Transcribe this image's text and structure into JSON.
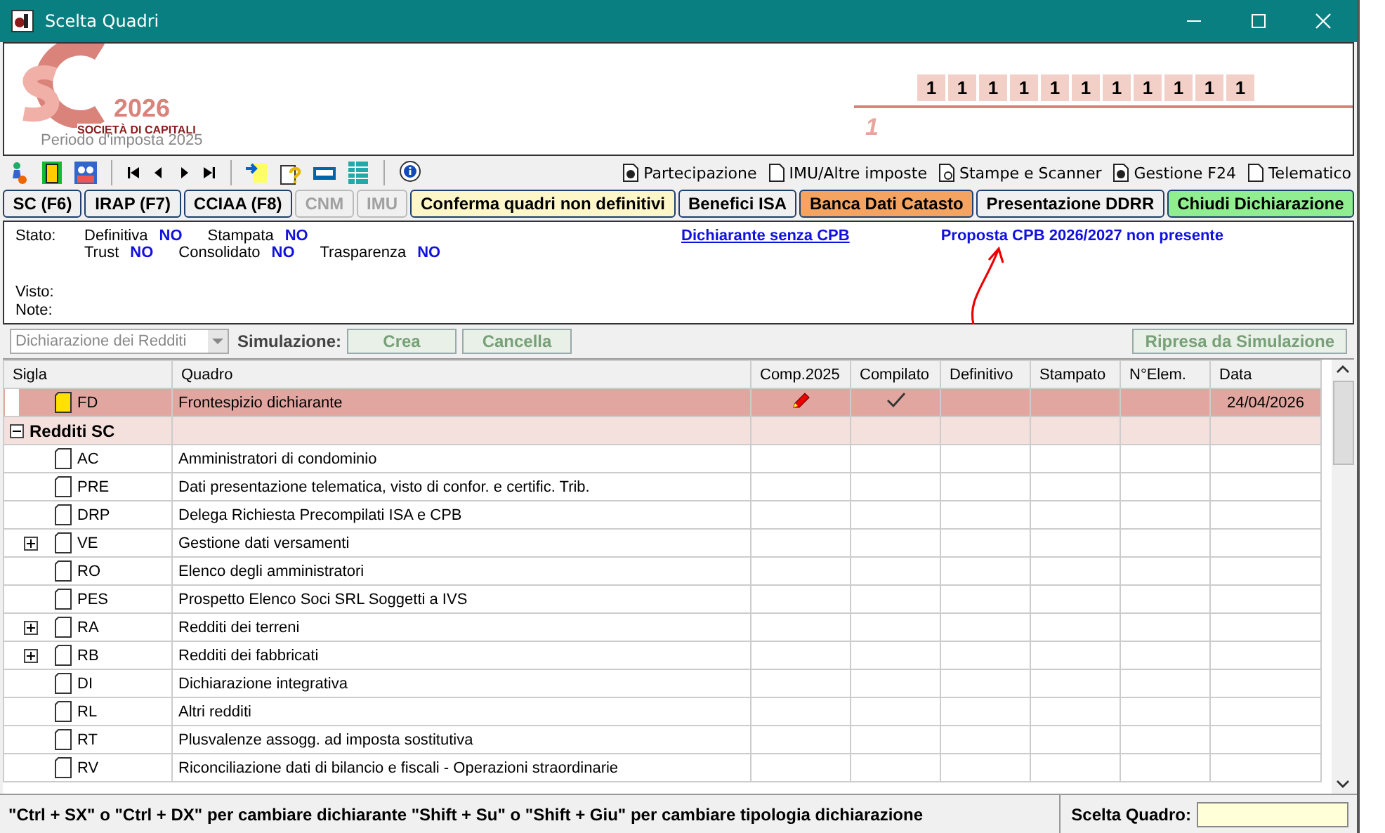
{
  "window": {
    "title": "Scelta Quadri"
  },
  "logo": {
    "year": "2026",
    "subtitle": "SOCIETÀ DI CAPITALI",
    "period": "Periodo d'imposta 2025"
  },
  "header": {
    "code_boxes": [
      "1",
      "1",
      "1",
      "1",
      "1",
      "1",
      "1",
      "1",
      "1",
      "1",
      "1"
    ],
    "page_number": "1"
  },
  "toolbar": {
    "links": [
      "Partecipazione",
      "IMU/Altre imposte",
      "Stampe e Scanner",
      "Gestione F24",
      "Telematico"
    ]
  },
  "action_buttons": [
    {
      "label": "SC (F6)",
      "disabled": false,
      "color": "#f0f0f0"
    },
    {
      "label": "IRAP (F7)",
      "disabled": false,
      "color": "#f0f0f0"
    },
    {
      "label": "CCIAA (F8)",
      "disabled": false,
      "color": "#f0f0f0"
    },
    {
      "label": "CNM",
      "disabled": true,
      "color": "#f0f0f0"
    },
    {
      "label": "IMU",
      "disabled": true,
      "color": "#f0f0f0"
    },
    {
      "label": "Conferma quadri non definitivi",
      "disabled": false,
      "color": "#fdf6c8"
    },
    {
      "label": "Benefici ISA",
      "disabled": false,
      "color": "#f0f0f0"
    },
    {
      "label": "Banca Dati Catasto",
      "disabled": false,
      "color": "#f4a460"
    },
    {
      "label": "Presentazione DDRR",
      "disabled": false,
      "color": "#f0f0f0"
    },
    {
      "label": "Chiudi Dichiarazione",
      "disabled": false,
      "color": "#90ee90"
    }
  ],
  "status": {
    "label": "Stato:",
    "flags_row_1": [
      {
        "label": "Definitiva",
        "value": "NO"
      },
      {
        "label": "Stampata",
        "value": "NO"
      }
    ],
    "flags_row_2": [
      {
        "label": "Trust",
        "value": "NO"
      },
      {
        "label": "Consolidato",
        "value": "NO"
      },
      {
        "label": "Trasparenza",
        "value": "NO"
      }
    ],
    "link": "Dichiarante senza CPB",
    "notice": "Proposta CPB 2026/2027 non presente",
    "visto_label": "Visto:",
    "note_label": "Note:"
  },
  "simulation": {
    "dropdown_value": "Dichiarazione dei Redditi",
    "label": "Simulazione:",
    "buttons": [
      {
        "label": "Crea",
        "disabled": true
      },
      {
        "label": "Cancella",
        "disabled": true
      }
    ],
    "resume_button": {
      "label": "Ripresa da Simulazione",
      "disabled": true
    }
  },
  "table": {
    "columns": [
      "Sigla",
      "Quadro",
      "Comp.2025",
      "Compilato",
      "Definitivo",
      "Stampato",
      "N°Elem.",
      "Data"
    ],
    "rows": [
      {
        "kind": "item",
        "sigla": "FD",
        "quadro": "Frontespizio dichiarante",
        "selected": true,
        "filled": true,
        "expandable": false,
        "comp_edit": true,
        "compilato": true,
        "data": "24/04/2026"
      },
      {
        "kind": "group",
        "label": "Redditi SC",
        "expanded": true
      },
      {
        "kind": "item",
        "sigla": "AC",
        "quadro": "Amministratori di condominio",
        "selected": false,
        "filled": false,
        "expandable": false,
        "comp_edit": false,
        "compilato": false
      },
      {
        "kind": "item",
        "sigla": "PRE",
        "quadro": "Dati presentazione telematica, visto di confor. e certific. Trib.",
        "selected": false,
        "filled": false,
        "expandable": false,
        "comp_edit": false,
        "compilato": false
      },
      {
        "kind": "item",
        "sigla": "DRP",
        "quadro": "Delega Richiesta Precompilati ISA e CPB",
        "selected": false,
        "filled": false,
        "expandable": false,
        "comp_edit": false,
        "compilato": false
      },
      {
        "kind": "item",
        "sigla": "VE",
        "quadro": "Gestione dati versamenti",
        "selected": false,
        "filled": false,
        "expandable": true,
        "comp_edit": false,
        "compilato": false
      },
      {
        "kind": "item",
        "sigla": "RO",
        "quadro": "Elenco degli amministratori",
        "selected": false,
        "filled": false,
        "expandable": false,
        "comp_edit": false,
        "compilato": false
      },
      {
        "kind": "item",
        "sigla": "PES",
        "quadro": "Prospetto Elenco Soci SRL Soggetti a IVS",
        "selected": false,
        "filled": false,
        "expandable": false,
        "comp_edit": false,
        "compilato": false
      },
      {
        "kind": "item",
        "sigla": "RA",
        "quadro": "Redditi dei terreni",
        "selected": false,
        "filled": false,
        "expandable": true,
        "comp_edit": false,
        "compilato": false
      },
      {
        "kind": "item",
        "sigla": "RB",
        "quadro": "Redditi dei fabbricati",
        "selected": false,
        "filled": false,
        "expandable": true,
        "comp_edit": false,
        "compilato": false
      },
      {
        "kind": "item",
        "sigla": "DI",
        "quadro": "Dichiarazione integrativa",
        "selected": false,
        "filled": false,
        "expandable": false,
        "comp_edit": false,
        "compilato": false
      },
      {
        "kind": "item",
        "sigla": "RL",
        "quadro": "Altri redditi",
        "selected": false,
        "filled": false,
        "expandable": false,
        "comp_edit": false,
        "compilato": false
      },
      {
        "kind": "item",
        "sigla": "RT",
        "quadro": "Plusvalenze assogg. ad imposta sostitutiva",
        "selected": false,
        "filled": false,
        "expandable": false,
        "comp_edit": false,
        "compilato": false
      },
      {
        "kind": "item",
        "sigla": "RV",
        "quadro": "Riconciliazione dati di bilancio e fiscali - Operazioni straordinarie",
        "selected": false,
        "filled": false,
        "expandable": false,
        "comp_edit": false,
        "compilato": false
      }
    ]
  },
  "status_bar": {
    "hint": "\"Ctrl + SX\" o \"Ctrl + DX\" per cambiare dichiarante \"Shift + Su\" o \"Shift + Giu\" per cambiare tipologia dichiarazione",
    "field_label": "Scelta Quadro:"
  }
}
